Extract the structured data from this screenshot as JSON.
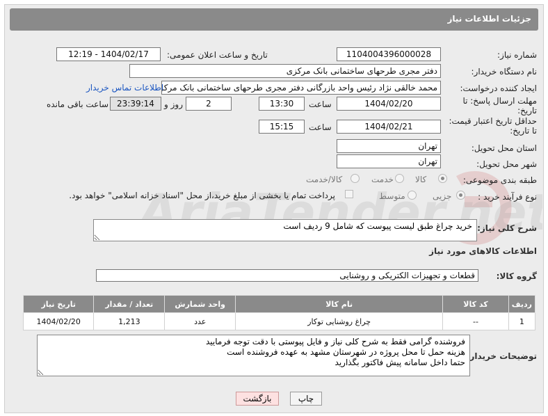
{
  "header": {
    "title": "جزئیات اطلاعات نیاز"
  },
  "watermark": {
    "text": "AriaTender.net"
  },
  "fields": {
    "need_number_label": "شماره نیاز:",
    "need_number": "1104004396000028",
    "announce_label": "تاریخ و ساعت اعلان عمومی:",
    "announce_value": "1404/02/17 - 12:19",
    "buyer_org_label": "نام دستگاه خریدار:",
    "buyer_org": "دفتر مجری طرحهای ساختمانی بانک مرکزی",
    "requester_label": "ایجاد کننده درخواست:",
    "requester": "محمد خالقی نژاد رئیس واحد بازرگانی دفتر مجری طرحهای ساختمانی بانک مرکزی",
    "contact_link": "اطلاعات تماس خریدار",
    "deadline_label_1": "مهلت ارسال پاسخ: تا",
    "deadline_label_2": "تاریخ:",
    "deadline_date": "1404/02/20",
    "time_label": "ساعت",
    "deadline_time": "13:30",
    "days_value": "2",
    "days_label": "روز و",
    "remaining_value": "23:39:14",
    "remaining_label": "ساعت باقی مانده",
    "min_validity_label_1": "حداقل تاریخ اعتبار قیمت:",
    "min_validity_label_2": "تا تاریخ:",
    "validity_date": "1404/02/21",
    "validity_time": "15:15",
    "province_label": "استان محل تحویل:",
    "province": "تهران",
    "city_label": "شهر محل تحویل:",
    "city": "تهران",
    "category_label": "طبقه بندی موضوعی:",
    "category_options": [
      "کالا",
      "خدمت",
      "کالا/خدمت"
    ],
    "process_label": "نوع فرآیند خرید :",
    "process_options": [
      "جزیی",
      "متوسط"
    ],
    "treasury_note": "پرداخت تمام یا بخشی از مبلغ خرید،از محل \"اسناد خزانه اسلامی\" خواهد بود."
  },
  "description": {
    "label": "شرح کلی نیاز:",
    "text": "خرید چراغ طبق لیست پیوست که شامل 9 ردیف است"
  },
  "goods_section": {
    "title": "اطلاعات کالاهای مورد نیاز",
    "group_label": "گروه کالا:",
    "group_value": "قطعات و تجهیزات الکتریکی و روشنایی",
    "columns": [
      "ردیف",
      "کد کالا",
      "نام کالا",
      "واحد شمارش",
      "تعداد / مقدار",
      "تاریخ نیاز"
    ],
    "rows": [
      [
        "1",
        "--",
        "چراغ روشنایی توکار",
        "عدد",
        "1,213",
        "1404/02/20"
      ]
    ]
  },
  "buyer_notes": {
    "label": "توضیحات خریدار:",
    "text": "فروشنده گرامی فقط به شرح کلی نیاز و فایل پیوستی با دقت توجه فرمایید\nهزینه حمل تا محل پروژه در شهرستان مشهد به عهده فروشنده است\nحتما داخل سامانه پیش فاکتور بگذارید"
  },
  "buttons": {
    "print": "چاپ",
    "back": "بازگشت"
  }
}
